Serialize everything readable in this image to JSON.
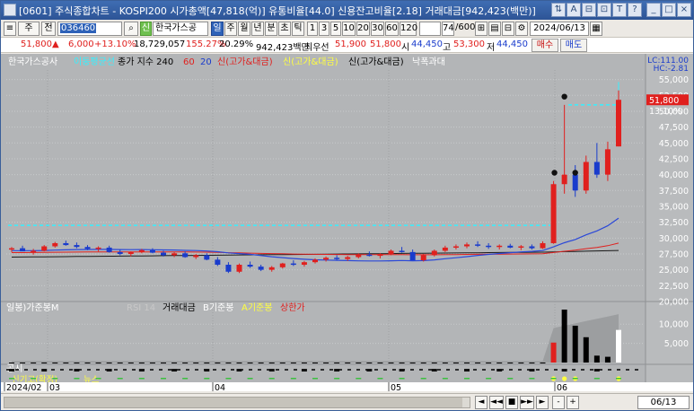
{
  "window": {
    "title": "[0601] 주식종합차트 - KOSPI200 시가총액[47,818(억)] 유통비율[44.0] 신용잔고비율[2.18] 거래대금[942,423(백만)]",
    "buttons": [
      "⇅",
      "A",
      "⊟",
      "⊡",
      "T",
      "?",
      "_",
      "□",
      "×"
    ]
  },
  "toolbar": {
    "main_tab": "주",
    "sub_tab": "전",
    "code_value": "036460",
    "credit_label": "신",
    "stock_name": "한국가스공",
    "periods": [
      "일",
      "주",
      "월",
      "년",
      "분",
      "초",
      "틱"
    ],
    "selected_period": "일",
    "minute_intervals": [
      "1",
      "3",
      "5",
      "10",
      "20",
      "30",
      "60",
      "120"
    ],
    "count_value": "74",
    "count_total": "/600",
    "date_value": "2024/06/13"
  },
  "quote": {
    "price": "51,800",
    "change_arrow": "▲",
    "change": "6,000",
    "change_pct": "+13.10%",
    "volume": "18,729,057",
    "volume_ratio": "155.27%",
    "turnover_ratio": "20.29%",
    "trade_amount": "942,423백만",
    "priority_label": "최우선",
    "ask_best": "51,900",
    "bid_best": "51,800",
    "open_label": "시",
    "open": "44,450",
    "high_label": "고",
    "high": "53,300",
    "low_label": "저",
    "low": "44,450",
    "buy_label": "매수",
    "sell_label": "매도"
  },
  "chart_data": {
    "type": "candlestick",
    "legend": [
      {
        "text": "한국가스공사",
        "color": "#ffffff"
      },
      {
        "text": "이동평균선",
        "color": "#35f0ff"
      },
      {
        "text": "종가 지수 240",
        "color": "#000000"
      },
      {
        "text": "60",
        "color": "#e0201e"
      },
      {
        "text": "20",
        "color": "#1a3ccc"
      },
      {
        "text": "신(고가&대금)",
        "color": "#e0201e"
      },
      {
        "text": "신(고가&대금)",
        "color": "#ffff40"
      },
      {
        "text": "신(고가&대금)",
        "color": "#000000"
      },
      {
        "text": "낙폭과대",
        "color": "#ffffff"
      }
    ],
    "price_axis": [
      "55,000",
      "52,500",
      "50,000",
      "47,500",
      "45,000",
      "42,500",
      "40,000",
      "37,500",
      "35,000",
      "32,500",
      "30,000",
      "27,500",
      "25,000",
      "22,500",
      "20,000"
    ],
    "price_range": [
      20000,
      56500
    ],
    "lc_label": "LC:111.00",
    "hc_label": "HC:-2.81",
    "current_price_tag": "51,800",
    "current_pct_tag": "13.10%",
    "candles": [
      [
        28200,
        28600,
        27800,
        28400
      ],
      [
        28400,
        28800,
        28000,
        27900
      ],
      [
        27900,
        28300,
        27400,
        28000
      ],
      [
        28000,
        28900,
        27900,
        28700
      ],
      [
        28700,
        29400,
        28500,
        29200
      ],
      [
        29200,
        29600,
        28800,
        28900
      ],
      [
        28900,
        29300,
        28400,
        28600
      ],
      [
        28600,
        28900,
        28100,
        28300
      ],
      [
        28300,
        28700,
        27900,
        28500
      ],
      [
        28500,
        28800,
        27700,
        27800
      ],
      [
        27800,
        28200,
        27300,
        27500
      ],
      [
        27500,
        27900,
        27100,
        27800
      ],
      [
        27800,
        28300,
        27600,
        28100
      ],
      [
        28100,
        28400,
        27600,
        27700
      ],
      [
        27700,
        28000,
        27100,
        27300
      ],
      [
        27300,
        27800,
        27000,
        27600
      ],
      [
        27600,
        27900,
        26900,
        27000
      ],
      [
        27000,
        27500,
        26700,
        27300
      ],
      [
        27300,
        27600,
        26500,
        26600
      ],
      [
        26600,
        27000,
        25600,
        25800
      ],
      [
        25800,
        26200,
        24500,
        24700
      ],
      [
        24700,
        26000,
        24500,
        25800
      ],
      [
        25800,
        26300,
        25300,
        25500
      ],
      [
        25500,
        25800,
        24800,
        25000
      ],
      [
        25000,
        25600,
        24700,
        25400
      ],
      [
        25400,
        26100,
        25200,
        26000
      ],
      [
        26000,
        26500,
        25600,
        25800
      ],
      [
        25800,
        26400,
        25500,
        26200
      ],
      [
        26200,
        26800,
        26000,
        26600
      ],
      [
        26600,
        27100,
        26300,
        26900
      ],
      [
        26900,
        27300,
        26500,
        26700
      ],
      [
        26700,
        27200,
        26400,
        27000
      ],
      [
        27000,
        27600,
        26800,
        27400
      ],
      [
        27400,
        27900,
        27100,
        27200
      ],
      [
        27200,
        27600,
        26800,
        27500
      ],
      [
        27500,
        28200,
        27300,
        28000
      ],
      [
        28000,
        28600,
        27700,
        27800
      ],
      [
        27800,
        28200,
        27300,
        26500
      ],
      [
        26500,
        27500,
        26300,
        27300
      ],
      [
        27300,
        28200,
        27100,
        28000
      ],
      [
        28000,
        28800,
        27800,
        28500
      ],
      [
        28500,
        29000,
        28200,
        28700
      ],
      [
        28700,
        29300,
        28400,
        29000
      ],
      [
        29000,
        29500,
        28600,
        28800
      ],
      [
        28800,
        29200,
        28300,
        28600
      ],
      [
        28600,
        29000,
        28200,
        28800
      ],
      [
        28800,
        29100,
        28400,
        28500
      ],
      [
        28500,
        28900,
        28100,
        28700
      ],
      [
        28700,
        29000,
        28200,
        28400
      ],
      [
        28400,
        29500,
        28300,
        29200
      ],
      [
        29200,
        39000,
        29100,
        38500
      ],
      [
        38500,
        51000,
        37000,
        40000
      ],
      [
        40000,
        41500,
        36500,
        37500
      ],
      [
        37500,
        43000,
        37000,
        42000
      ],
      [
        42000,
        45000,
        39500,
        40000
      ],
      [
        40000,
        45200,
        39000,
        44000
      ],
      [
        44450,
        53300,
        44450,
        51800
      ]
    ],
    "volume_axis": [
      "10,000",
      "5,000"
    ],
    "volume_legend": [
      "일봉)가준봉M",
      "RSI 14",
      "거래대금",
      "B기준봉",
      "A기준봉",
      "상한가"
    ],
    "volumes": [
      1,
      1,
      1,
      1,
      1,
      1,
      1,
      1,
      1,
      1,
      1,
      1,
      1,
      1,
      1,
      1,
      1,
      1,
      1,
      1,
      1,
      1,
      1,
      1,
      1,
      1,
      1,
      1,
      1,
      1,
      1,
      1,
      1,
      1,
      1,
      1,
      1,
      1,
      1,
      1,
      1,
      1,
      1,
      1,
      1,
      1,
      1,
      1,
      1,
      1,
      5200,
      13800,
      9600,
      6600,
      1800,
      1500,
      8500
    ],
    "notice_label": "공시",
    "signal_label": "신기고(확정)",
    "signal_label2": "뉴스",
    "date_labels": [
      "2024/02",
      "03",
      "04",
      "05",
      "06"
    ]
  },
  "bottom": {
    "date_value": "06/13",
    "nav_buttons": [
      "◄",
      "◄◄",
      "■",
      "►►",
      "►",
      "-",
      "+"
    ]
  }
}
